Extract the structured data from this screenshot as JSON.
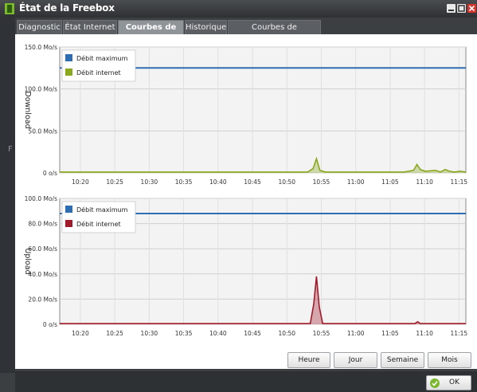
{
  "window": {
    "title": "État de la Freebox",
    "accent_color": "#8dc63f",
    "close_color": "#d9342b"
  },
  "tabs": [
    {
      "label": "Diagnostic",
      "active": false
    },
    {
      "label": "État Internet",
      "active": false
    },
    {
      "label": "Courbes de Débit",
      "active": true
    },
    {
      "label": "Historique",
      "active": false
    },
    {
      "label": "Courbes de température",
      "active": false
    }
  ],
  "buttons": {
    "hour": "Heure",
    "day": "Jour",
    "week": "Semaine",
    "month": "Mois",
    "ok": "OK"
  },
  "side_edge_mark": "F",
  "chart_data": [
    {
      "type": "line",
      "name": "download",
      "ylabel": "Download",
      "y_ticks": [
        "0 o/s",
        "50.0 Mo/s",
        "100.0 Mo/s",
        "150.0 Mo/s"
      ],
      "y_tick_values": [
        0,
        50,
        100,
        150
      ],
      "ylim": [
        0,
        150
      ],
      "x_ticks": [
        "10:20",
        "10:25",
        "10:30",
        "10:35",
        "10:40",
        "10:45",
        "10:50",
        "10:55",
        "11:00",
        "11:05",
        "11:10",
        "11:15"
      ],
      "xlim": [
        0,
        59
      ],
      "grid": true,
      "legend": "top-left",
      "series": [
        {
          "name": "Débit maximum",
          "color": "#2f6db3",
          "x": [
            0,
            59
          ],
          "values": [
            125,
            125
          ]
        },
        {
          "name": "Débit internet",
          "color": "#8aa81f",
          "x": [
            0,
            36,
            36.8,
            37.3,
            37.8,
            38.6,
            50,
            51.4,
            51.9,
            52.4,
            53.1,
            54.6,
            55.3,
            56,
            56.6,
            57.3,
            58.2,
            59
          ],
          "values": [
            1,
            1,
            5,
            17,
            3,
            1,
            1,
            3,
            10,
            4,
            2,
            3,
            1,
            4,
            2,
            1,
            2,
            1
          ]
        }
      ]
    },
    {
      "type": "line",
      "name": "upload",
      "ylabel": "Upload",
      "y_ticks": [
        "0 o/s",
        "20.0 Mo/s",
        "40.0 Mo/s",
        "60.0 Mo/s",
        "80.0 Mo/s",
        "100.0 Mo/s"
      ],
      "y_tick_values": [
        0,
        20,
        40,
        60,
        80,
        100
      ],
      "ylim": [
        0,
        100
      ],
      "x_ticks": [
        "10:20",
        "10:25",
        "10:30",
        "10:35",
        "10:40",
        "10:45",
        "10:50",
        "10:55",
        "11:00",
        "11:05",
        "11:10",
        "11:15"
      ],
      "xlim": [
        0,
        59
      ],
      "grid": true,
      "legend": "top-left",
      "series": [
        {
          "name": "Débit maximum",
          "color": "#2f6db3",
          "x": [
            0,
            59
          ],
          "values": [
            88,
            88
          ]
        },
        {
          "name": "Débit internet",
          "color": "#a01c2a",
          "x": [
            0,
            36.4,
            36.9,
            37.3,
            37.7,
            38.2,
            51.6,
            52,
            52.4,
            59
          ],
          "values": [
            0.5,
            0.5,
            16,
            38,
            14,
            0.5,
            0.5,
            2,
            0.5,
            0.5
          ]
        }
      ]
    }
  ]
}
